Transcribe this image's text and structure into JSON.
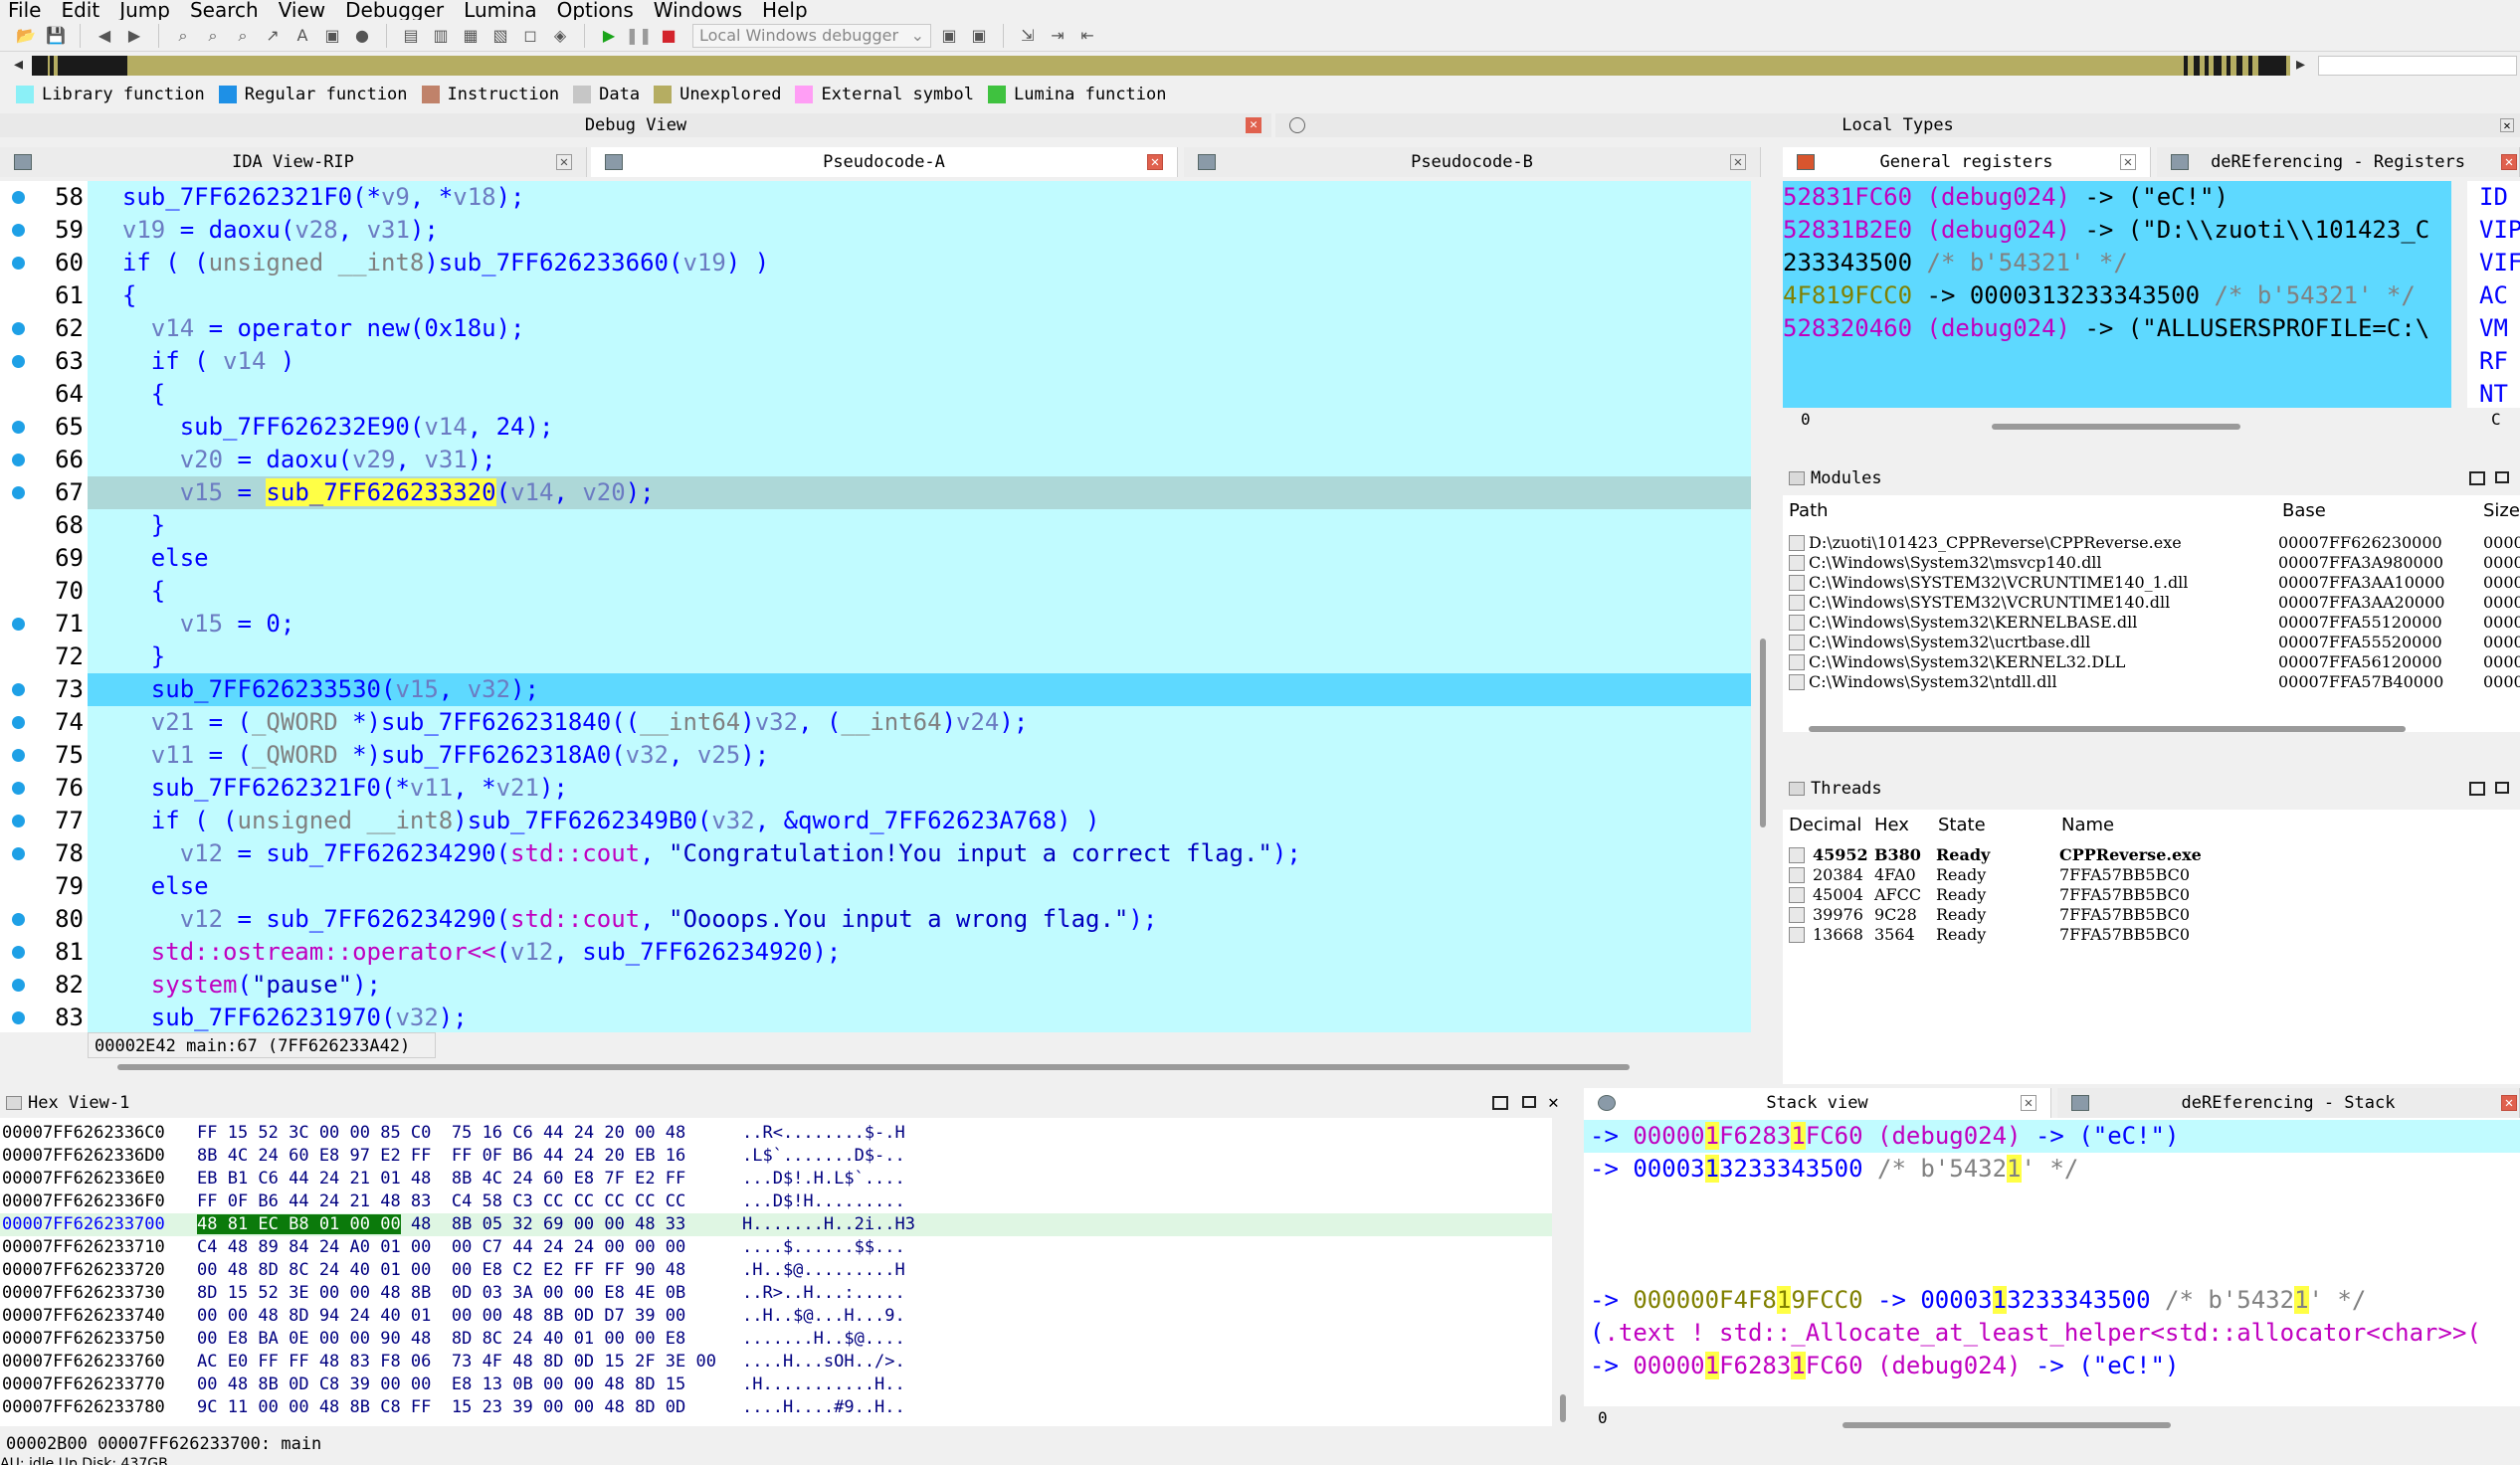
{
  "menu": [
    "File",
    "Edit",
    "Jump",
    "Search",
    "View",
    "Debugger",
    "Lumina",
    "Options",
    "Windows",
    "Help"
  ],
  "toolbar": {
    "debugger_label": "Local Windows debugger"
  },
  "legend": [
    {
      "label": "Library function",
      "color": "#8bf0f7"
    },
    {
      "label": "Regular function",
      "color": "#1e90e6"
    },
    {
      "label": "Instruction",
      "color": "#c0826a"
    },
    {
      "label": "Data",
      "color": "#c6c6c6"
    },
    {
      "label": "Unexplored",
      "color": "#b5ad62"
    },
    {
      "label": "External symbol",
      "color": "#ff9ef5"
    },
    {
      "label": "Lumina function",
      "color": "#3fc23f"
    }
  ],
  "panels": {
    "debug_view": "Debug View",
    "local_types": "Local Types",
    "tabs": [
      {
        "label": "IDA View-RIP"
      },
      {
        "label": "Pseudocode-A"
      },
      {
        "label": "Pseudocode-B"
      },
      {
        "label": "General registers"
      },
      {
        "label": "deREferencing - Registers"
      }
    ],
    "modules_title": "Modules",
    "threads_title": "Threads",
    "hex_title": "Hex View-1",
    "stack_title": "Stack view",
    "deref_stack_title": "deREferencing - Stack"
  },
  "code": {
    "lines": [
      {
        "n": "58",
        "html": "  sub_7FF6262321F0(*<span class='v'>v9</span>, *<span class='v'>v18</span>);"
      },
      {
        "n": "59",
        "html": "  <span class='v'>v19</span> = daoxu(<span class='v'>v28</span>, <span class='v'>v31</span>);"
      },
      {
        "n": "60",
        "html": "  if ( (<span class='c'>unsigned __int8</span>)sub_7FF626233660(<span class='v'>v19</span>) )"
      },
      {
        "n": "61",
        "html": "  {"
      },
      {
        "n": "62",
        "html": "    <span class='v'>v14</span> = operator new(0x18u);"
      },
      {
        "n": "63",
        "html": "    if ( <span class='v'>v14</span> )"
      },
      {
        "n": "64",
        "html": "    {"
      },
      {
        "n": "65",
        "html": "      sub_7FF626232E90(<span class='v'>v14</span>, 24);"
      },
      {
        "n": "66",
        "html": "      <span class='v'>v20</span> = daoxu(<span class='v'>v29</span>, <span class='v'>v31</span>);"
      },
      {
        "n": "67",
        "html": "      <span class='v'>v15</span> = <span class='hl'>sub_7FF626233320</span>(<span class='v'>v14</span>, <span class='v'>v20</span>);"
      },
      {
        "n": "68",
        "html": "    }"
      },
      {
        "n": "69",
        "html": "    else"
      },
      {
        "n": "70",
        "html": "    {"
      },
      {
        "n": "71",
        "html": "      <span class='v'>v15</span> = 0;"
      },
      {
        "n": "72",
        "html": "    }"
      },
      {
        "n": "73",
        "html": "    sub_7FF626233530(<span class='v'>v15</span>, <span class='v'>v32</span>);"
      },
      {
        "n": "74",
        "html": "    <span class='v'>v21</span> = (<span class='c'>_QWORD</span> *)sub_7FF626231840((<span class='c'>__int64</span>)<span class='v'>v32</span>, (<span class='c'>__int64</span>)<span class='v'>v24</span>);"
      },
      {
        "n": "75",
        "html": "    <span class='v'>v11</span> = (<span class='c'>_QWORD</span> *)sub_7FF6262318A0(<span class='v'>v32</span>, <span class='v'>v25</span>);"
      },
      {
        "n": "76",
        "html": "    sub_7FF6262321F0(*<span class='v'>v11</span>, *<span class='v'>v21</span>);"
      },
      {
        "n": "77",
        "html": "    if ( (<span class='c'>unsigned __int8</span>)sub_7FF6262349B0(<span class='v'>v32</span>, &amp;qword_7FF62623A768) )"
      },
      {
        "n": "78",
        "html": "      <span class='v'>v12</span> = sub_7FF626234290(<span class='m'>std::cout</span>, <span class='s'>\"Congratulation!You input a correct flag.\"</span>);"
      },
      {
        "n": "79",
        "html": "    else"
      },
      {
        "n": "80",
        "html": "      <span class='v'>v12</span> = sub_7FF626234290(<span class='m'>std::cout</span>, <span class='s'>\"Oooops.You input a wrong flag.\"</span>);"
      },
      {
        "n": "81",
        "html": "    <span class='m'>std::ostream::operator&lt;&lt;</span>(<span class='v'>v12</span>, sub_7FF626234920);"
      },
      {
        "n": "82",
        "html": "    <span class='m'>system</span>(<span class='s'>\"pause\"</span>);"
      },
      {
        "n": "83",
        "html": "    sub_7FF626231970(<span class='v'>v32</span>);"
      }
    ],
    "current_line": "67",
    "pc_line": "73",
    "status": "00002E42 main:67 (7FF626233A42)"
  },
  "registers": [
    {
      "html": "<span class='m'>52831FC60</span> <span class='m'>(debug024)</span> -&gt; (\"eC!\")"
    },
    {
      "html": "<span class='m'>52831B2E0</span> <span class='m'>(debug024)</span> -&gt; (\"D:\\\\zuoti\\\\101423_C"
    },
    {
      "html": "233343500 <span class='c'>/* b'54321' */</span>"
    },
    {
      "html": "<span class='g'>4F819FCC0</span> -&gt; 0000313233343500 <span class='c'>/* b'54321' */</span>"
    },
    {
      "html": "<span class='m'>528320460</span> <span class='m'>(debug024)</span> -&gt; (\"ALLUSERSPROFILE=C:\\"
    },
    {
      "html": ""
    },
    {
      "html": ""
    }
  ],
  "flags": [
    "ID",
    "VIP",
    "VIF",
    "AC",
    "VM",
    "RF",
    "NT"
  ],
  "registers_footer": "0",
  "flags_footer": "C",
  "modules": {
    "headers": [
      "Path",
      "Base",
      "Size"
    ],
    "rows": [
      {
        "path": "D:\\zuoti\\101423_CPPReverse\\CPPReverse.exe",
        "base": "00007FF626230000",
        "size": "0000"
      },
      {
        "path": "C:\\Windows\\System32\\msvcp140.dll",
        "base": "00007FFA3A980000",
        "size": "0000"
      },
      {
        "path": "C:\\Windows\\SYSTEM32\\VCRUNTIME140_1.dll",
        "base": "00007FFA3AA10000",
        "size": "0000"
      },
      {
        "path": "C:\\Windows\\SYSTEM32\\VCRUNTIME140.dll",
        "base": "00007FFA3AA20000",
        "size": "0000"
      },
      {
        "path": "C:\\Windows\\System32\\KERNELBASE.dll",
        "base": "00007FFA55120000",
        "size": "0000"
      },
      {
        "path": "C:\\Windows\\System32\\ucrtbase.dll",
        "base": "00007FFA55520000",
        "size": "0000"
      },
      {
        "path": "C:\\Windows\\System32\\KERNEL32.DLL",
        "base": "00007FFA56120000",
        "size": "0000"
      },
      {
        "path": "C:\\Windows\\System32\\ntdll.dll",
        "base": "00007FFA57B40000",
        "size": "0000"
      }
    ]
  },
  "threads": {
    "headers": [
      "Decimal",
      "Hex",
      "State",
      "Name"
    ],
    "rows": [
      {
        "dec": "45952",
        "hex": "B380",
        "state": "Ready",
        "name": "CPPReverse.exe",
        "bold": true
      },
      {
        "dec": "20384",
        "hex": "4FA0",
        "state": "Ready",
        "name": "7FFA57BB5BC0",
        "bold": false
      },
      {
        "dec": "45004",
        "hex": "AFCC",
        "state": "Ready",
        "name": "7FFA57BB5BC0",
        "bold": false
      },
      {
        "dec": "39976",
        "hex": "9C28",
        "state": "Ready",
        "name": "7FFA57BB5BC0",
        "bold": false
      },
      {
        "dec": "13668",
        "hex": "3564",
        "state": "Ready",
        "name": "7FFA57BB5BC0",
        "bold": false
      }
    ]
  },
  "hex": {
    "rows": [
      {
        "addr": "00007FF6262336C0",
        "bytes": "FF 15 52 3C 00 00 85 C0  75 16 C6 44 24 20 00 48",
        "ascii": "..R<........$-.H"
      },
      {
        "addr": "00007FF6262336D0",
        "bytes": "8B 4C 24 60 E8 97 E2 FF  FF 0F B6 44 24 20 EB 16",
        "ascii": ".L$`.......D$-.."
      },
      {
        "addr": "00007FF6262336E0",
        "bytes": "EB B1 C6 44 24 21 01 48  8B 4C 24 60 E8 7F E2 FF",
        "ascii": "...D$!.H.L$`...."
      },
      {
        "addr": "00007FF6262336F0",
        "bytes": "FF 0F B6 44 24 21 48 83  C4 58 C3 CC CC CC CC CC",
        "ascii": "...D$!H........."
      },
      {
        "addr": "00007FF626233700",
        "bytes": "48 81 EC B8 01 00 00 48  8B 05 32 69 00 00 48 33",
        "ascii": "H.......H..2i..H3",
        "cur": true
      },
      {
        "addr": "00007FF626233710",
        "bytes": "C4 48 89 84 24 A0 01 00  00 C7 44 24 24 00 00 00",
        "ascii": "....$......$$..."
      },
      {
        "addr": "00007FF626233720",
        "bytes": "00 48 8D 8C 24 40 01 00  00 E8 C2 E2 FF FF 90 48",
        "ascii": ".H..$@.........H"
      },
      {
        "addr": "00007FF626233730",
        "bytes": "8D 15 52 3E 00 00 48 8B  0D 03 3A 00 00 E8 4E 0B",
        "ascii": "..R>..H...:....."
      },
      {
        "addr": "00007FF626233740",
        "bytes": "00 00 48 8D 94 24 40 01  00 00 48 8B 0D D7 39 00",
        "ascii": "..H..$@...H...9."
      },
      {
        "addr": "00007FF626233750",
        "bytes": "00 E8 BA 0E 00 00 90 48  8D 8C 24 40 01 00 00 E8",
        "ascii": ".......H..$@...."
      },
      {
        "addr": "00007FF626233760",
        "bytes": "AC E0 FF FF 48 83 F8 06  73 4F 48 8D 0D 15 2F 3E 00",
        "ascii": "....H...sOH../>."
      },
      {
        "addr": "00007FF626233770",
        "bytes": "00 48 8B 0D C8 39 00 00  E8 13 0B 00 00 48 8D 15",
        "ascii": ".H...........H.."
      },
      {
        "addr": "00007FF626233780",
        "bytes": "9C 11 00 00 48 8B C8 FF  15 23 39 00 00 48 8D 0D",
        "ascii": "....H....#9..H.."
      }
    ],
    "status": "00002B00 00007FF626233700: main"
  },
  "stack": [
    {
      "html": "-&gt; <span class='m'>00000<span class='y'>1</span>F6283<span class='y'>1</span>FC60</span> <span class='m'>(debug024)</span> -&gt; (\"eC!\")",
      "pc": true
    },
    {
      "html": "-&gt; 00003<span class='y'>1</span>3233343500 <span class='c'>/* b'5432<span class='y'>1</span>' */</span>",
      "pc": false
    },
    {
      "html": "",
      "pc": false
    },
    {
      "html": "",
      "pc": false
    },
    {
      "html": "",
      "pc": false
    },
    {
      "html": "-&gt; <span class='g'>000000F4F8<span class='y'>1</span>9FCC0</span> -&gt; 00003<span class='y'>1</span>3233343500 <span class='c'>/* b'5432<span class='y'>1</span>' */</span>",
      "pc": false
    },
    {
      "html": "(<span class='m'>.text ! std::_Allocate_at_least_helper&lt;std::allocator&lt;char&gt;&gt;(</span>",
      "pc": false
    },
    {
      "html": "-&gt; <span class='m'>00000<span class='y'>1</span>F6283<span class='y'>1</span>FC60 (debug024)</span> -&gt; (\"eC!\")",
      "pc": false
    }
  ],
  "stack_footer": "0",
  "statusbar": "AU:  idle   Up     Disk: 437GB"
}
